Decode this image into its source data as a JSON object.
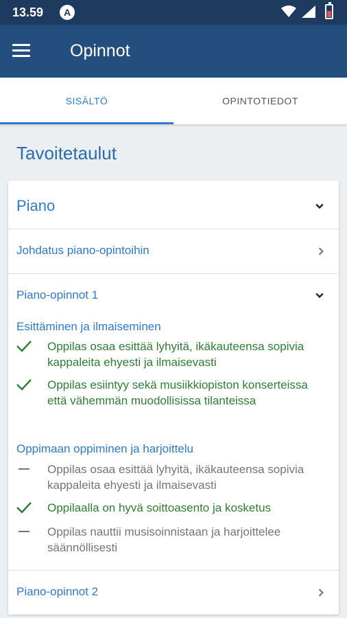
{
  "status_bar": {
    "time": "13.59",
    "notification_icon": "A"
  },
  "app_bar": {
    "title": "Opinnot",
    "menu_icon": "hamburger-menu-icon"
  },
  "tabs": [
    {
      "label": "SISÄLTÖ",
      "active": true
    },
    {
      "label": "OPINTOTIEDOT",
      "active": false
    }
  ],
  "section": {
    "title": "Tavoitetaulut"
  },
  "card": {
    "instrument": "Piano",
    "items": [
      {
        "title": "Johdatus piano-opintoihin"
      },
      {
        "title": "Piano-opinnot 1"
      },
      {
        "title": "Piano-opinnot 2"
      }
    ],
    "categories": [
      {
        "title": "Esittäminen ja ilmaiseminen",
        "goals": [
          {
            "text": "Oppilas osaa esittää lyhyitä, ikäkauteensa sopivia kappaleita ehyesti ja ilmaisevasti",
            "status": "done"
          },
          {
            "text": "Oppilas esiintyy sekä musiikkiopiston konserteissa että vähemmän muodollisissa tilanteissa",
            "status": "done"
          }
        ]
      },
      {
        "title": "Oppimaan oppiminen ja harjoittelu",
        "goals": [
          {
            "text": "Oppilas osaa esittää lyhyitä, ikäkauteensa sopivia kappaleita ehyesti ja ilmaisevasti",
            "status": "todo"
          },
          {
            "text": "Oppilaalla on hyvä soittoasento ja kosketus",
            "status": "done"
          },
          {
            "text": "Oppilas nauttii musisoinnistaan ja harjoittelee säännöllisesti",
            "status": "todo"
          }
        ]
      }
    ]
  },
  "colors": {
    "app_bar": "#234e7d",
    "status_bar": "#1f3a5f",
    "accent": "#2c7ac9",
    "done": "#2e7d32",
    "todo": "#757575"
  }
}
